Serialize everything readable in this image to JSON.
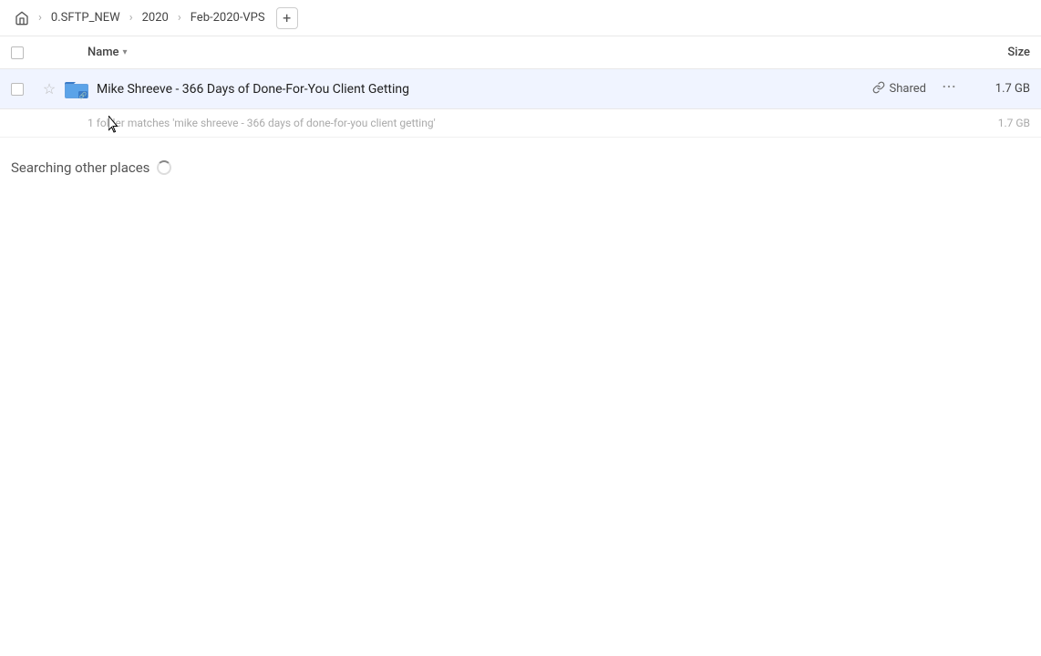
{
  "breadcrumb": {
    "home_icon": "🏠",
    "items": [
      {
        "label": "0.SFTP_NEW"
      },
      {
        "label": "2020"
      },
      {
        "label": "Feb-2020-VPS"
      }
    ],
    "add_button": "+"
  },
  "column_headers": {
    "name_label": "Name",
    "size_label": "Size",
    "chevron": "▾"
  },
  "file_row": {
    "name": "Mike Shreeve - 366 Days of Done-For-You Client Getting",
    "shared_label": "Shared",
    "size": "1.7 GB",
    "more_icon": "···"
  },
  "match_info": {
    "text": "1 folder matches 'mike shreeve - 366 days of done-for-you client getting'",
    "size": "1.7 GB"
  },
  "searching_section": {
    "label": "Searching other places"
  },
  "icons": {
    "link": "🔗",
    "star_empty": "☆",
    "home": "⌂"
  }
}
